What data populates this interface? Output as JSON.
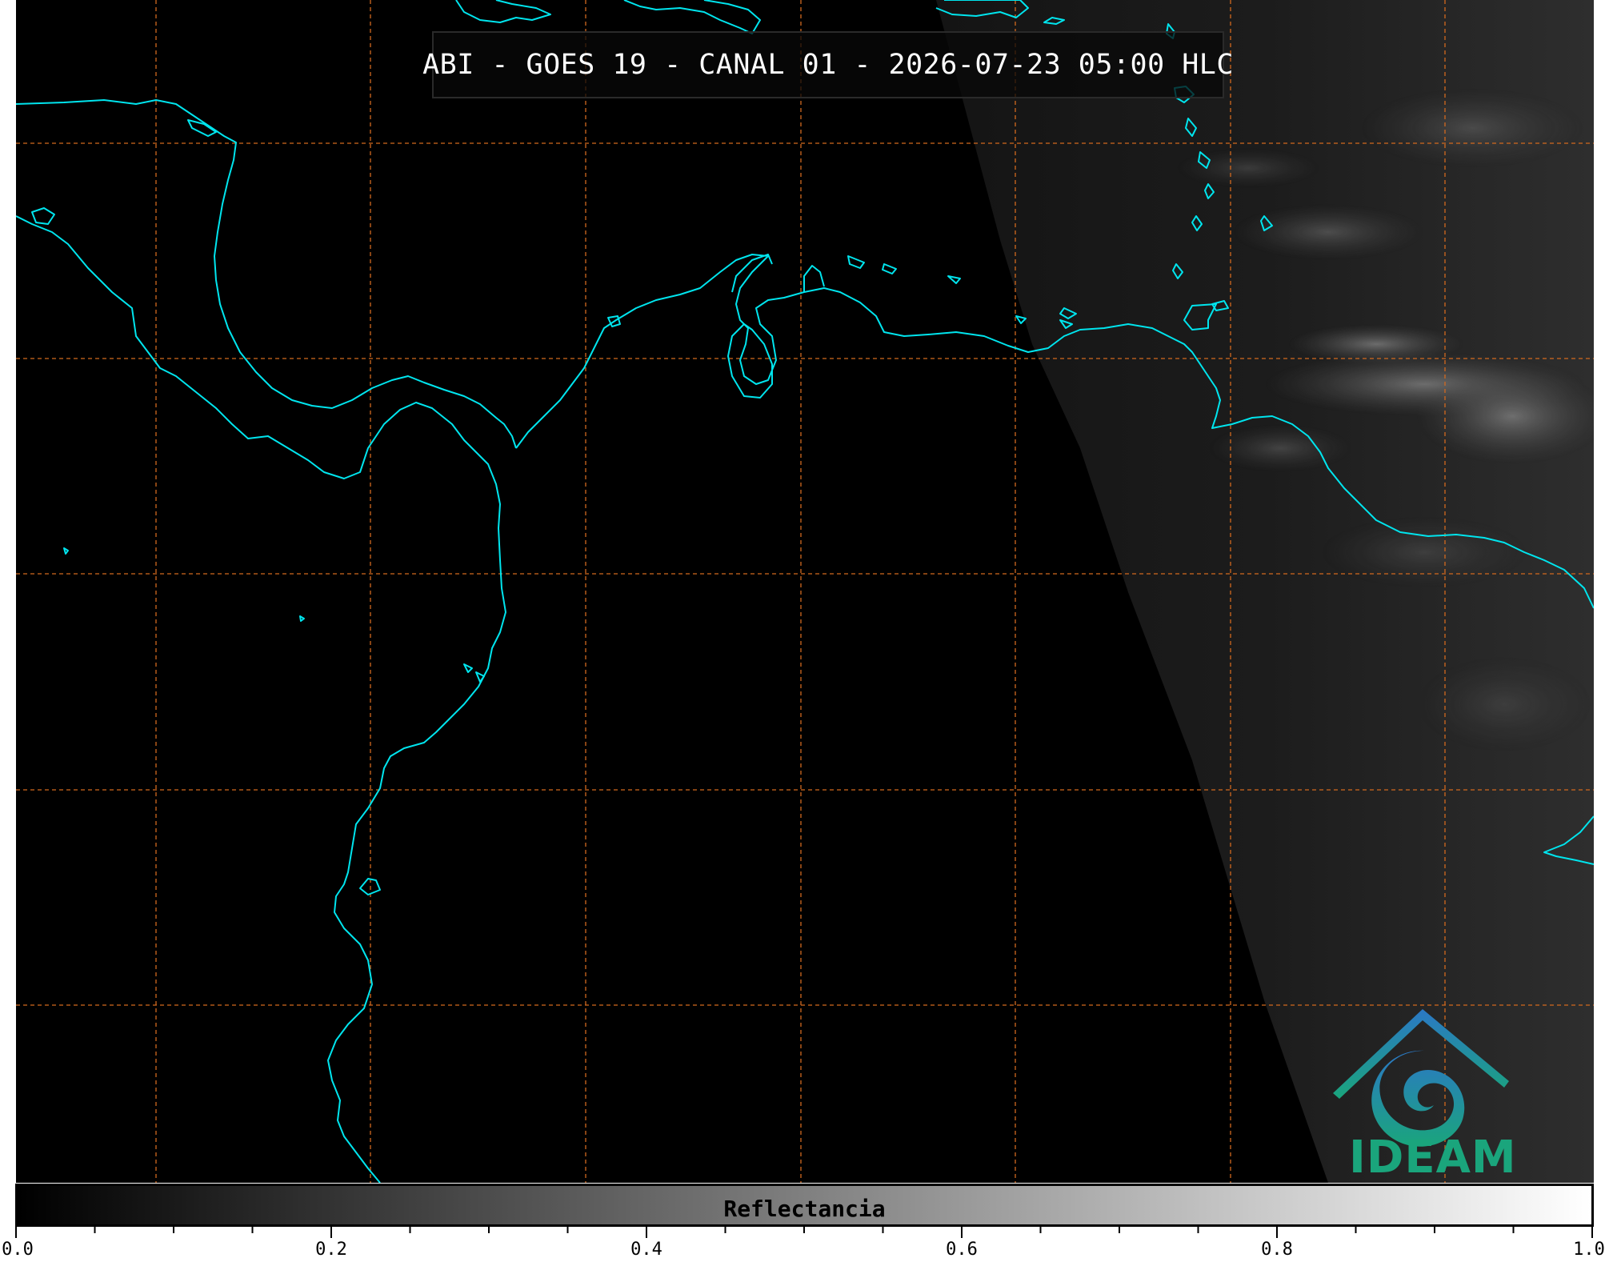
{
  "map": {
    "title": "ABI - GOES 19 - CANAL 01 - 2026-07-23 05:00 HLC",
    "coastline_color": "#00e5ee",
    "grid_color": "#d2691e",
    "background_color": "#000000"
  },
  "logo": {
    "text": "IDEAM",
    "colors": [
      "#2b78c5",
      "#1aa57c"
    ]
  },
  "colorbar": {
    "label": "Reflectancia",
    "min": 0.0,
    "max": 1.0,
    "ticks": [
      "0.0",
      "0.2",
      "0.4",
      "0.6",
      "0.8",
      "1.0"
    ],
    "minor_ticks_per_interval": 4,
    "gradient": [
      "#000000",
      "#ffffff"
    ]
  }
}
